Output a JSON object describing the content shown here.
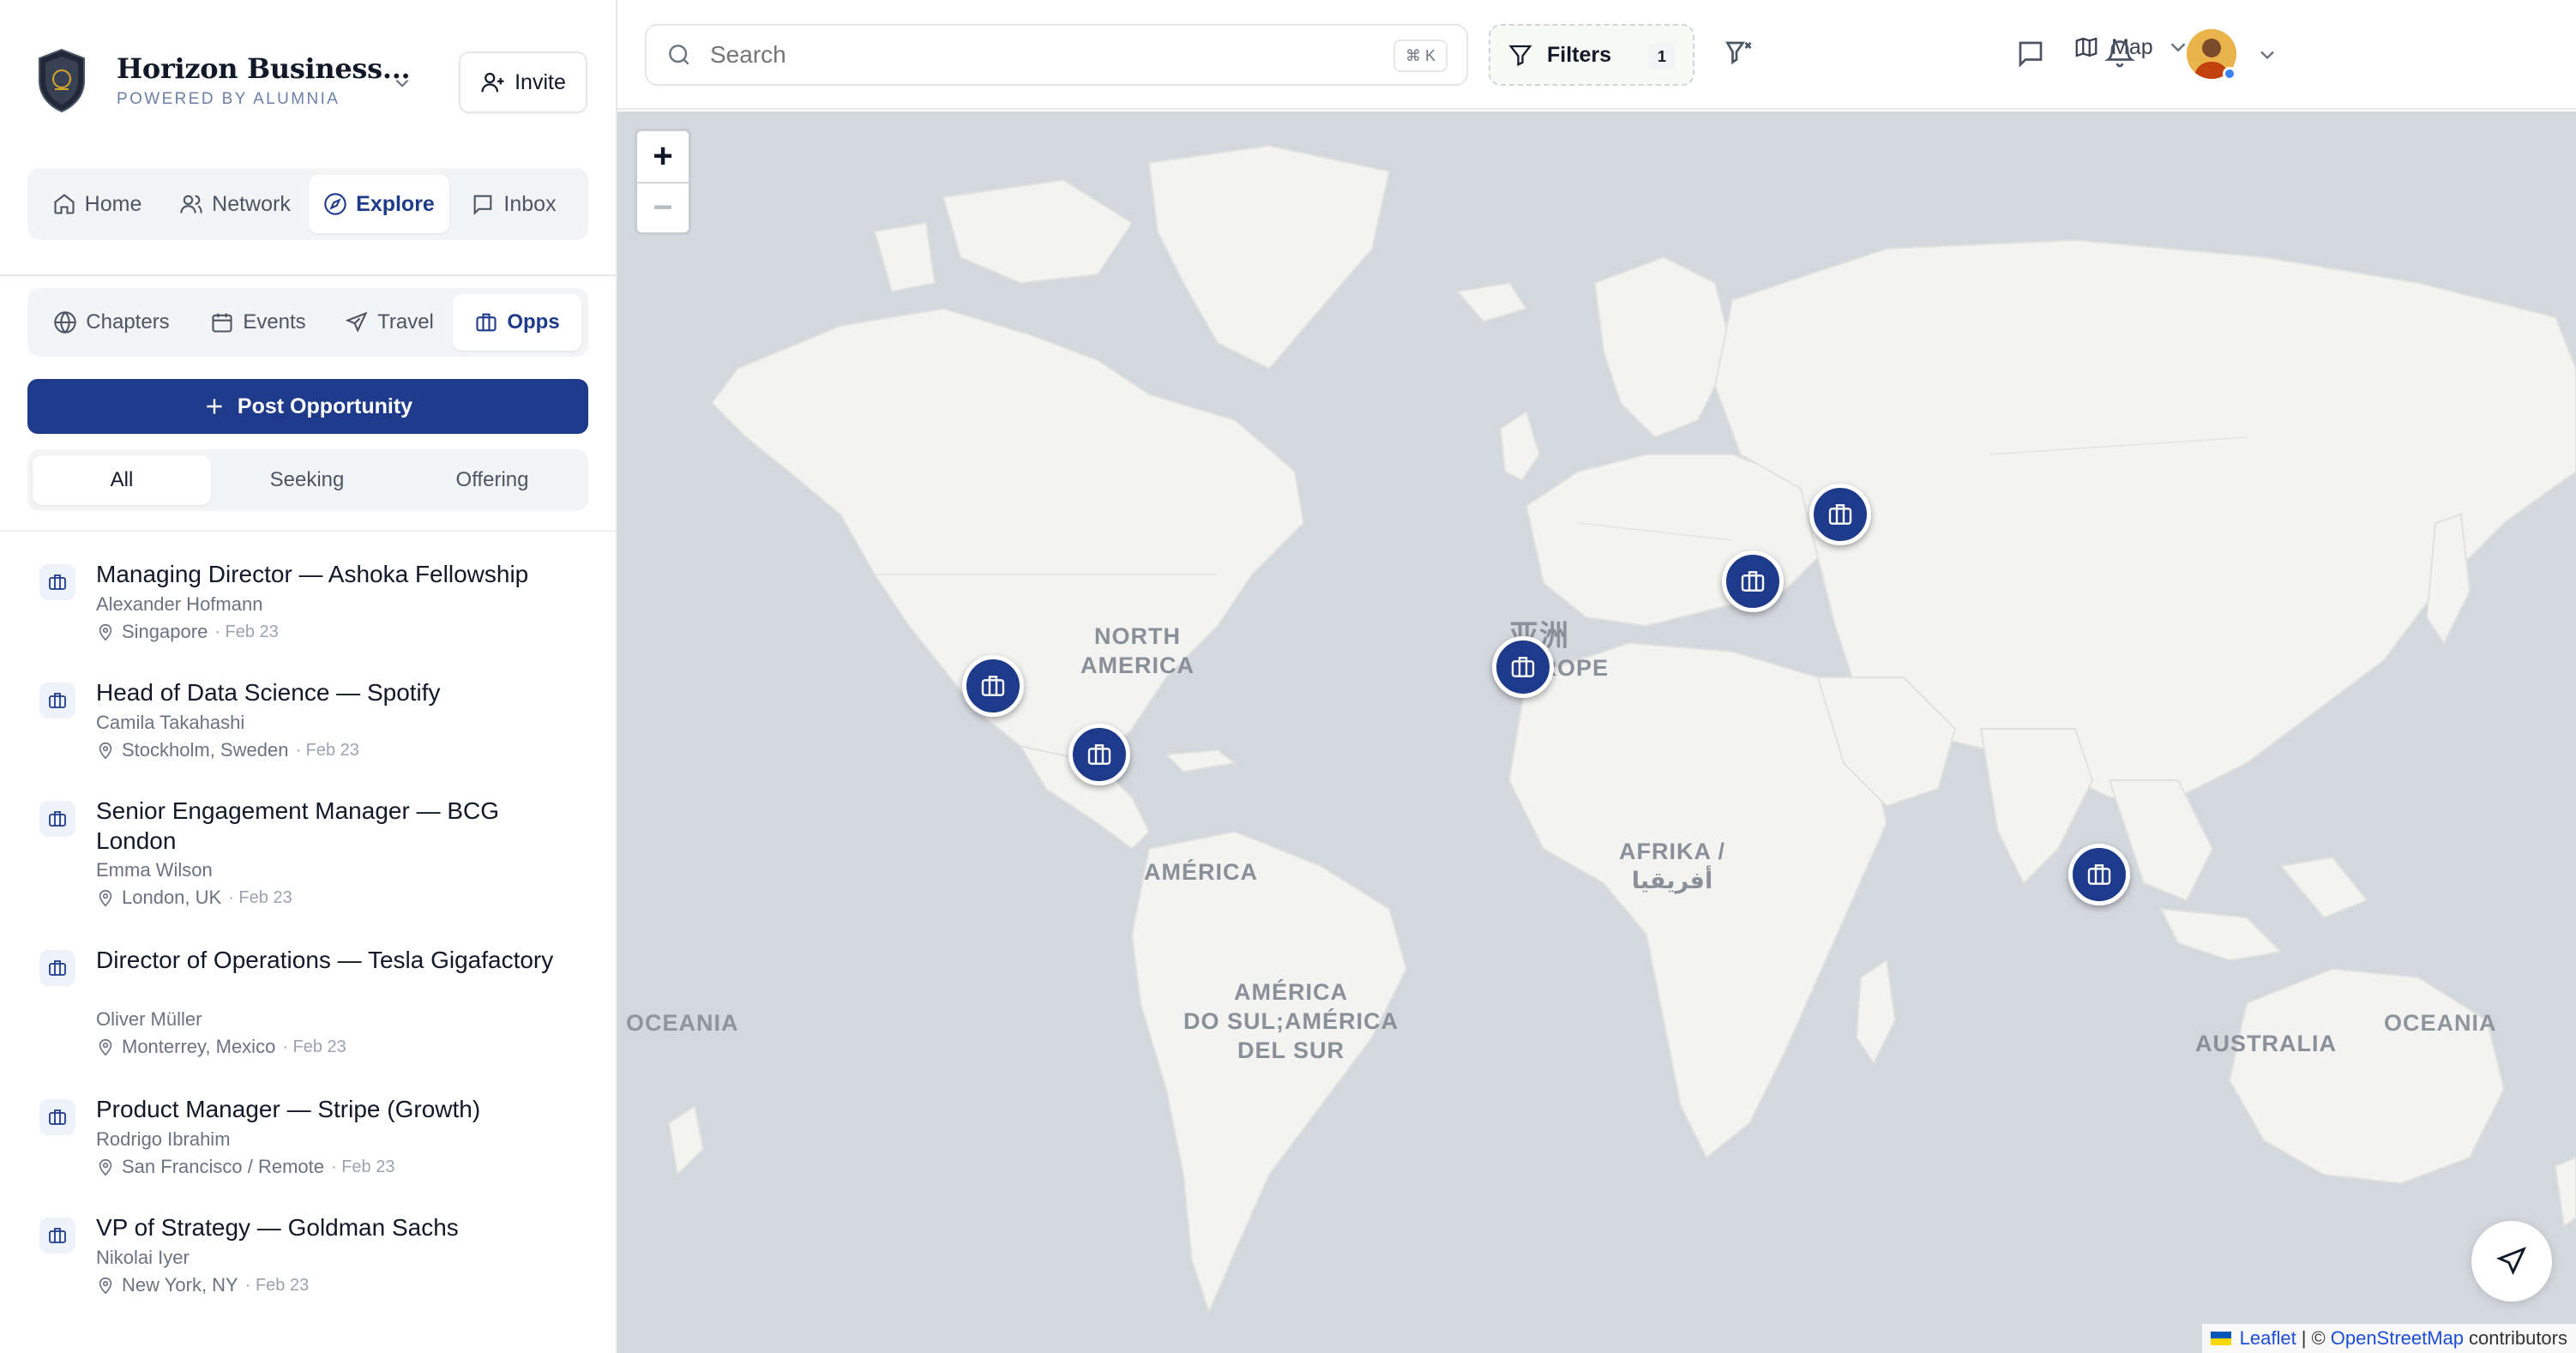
{
  "brand": {
    "name": "Horizon Business...",
    "subtitle": "POWERED BY ALUMNIA"
  },
  "invite_label": "Invite",
  "main_nav": [
    {
      "label": "Home",
      "icon": "home-icon"
    },
    {
      "label": "Network",
      "icon": "users-icon"
    },
    {
      "label": "Explore",
      "icon": "compass-icon",
      "active": true
    },
    {
      "label": "Inbox",
      "icon": "message-icon"
    }
  ],
  "sub_nav": [
    {
      "label": "Chapters",
      "icon": "globe-icon"
    },
    {
      "label": "Events",
      "icon": "calendar-icon"
    },
    {
      "label": "Travel",
      "icon": "plane-icon"
    },
    {
      "label": "Opps",
      "icon": "briefcase-icon",
      "active": true
    }
  ],
  "post_button": "Post Opportunity",
  "filter_tabs": [
    {
      "label": "All",
      "active": true
    },
    {
      "label": "Seeking"
    },
    {
      "label": "Offering"
    }
  ],
  "opportunities": [
    {
      "title": "Managing Director — Ashoka Fellowship",
      "person": "Alexander Hofmann",
      "location": "Singapore",
      "date": "· Feb 23"
    },
    {
      "title": "Head of Data Science — Spotify",
      "person": "Camila Takahashi",
      "location": "Stockholm, Sweden",
      "date": "· Feb 23"
    },
    {
      "title": "Senior Engagement Manager — BCG London",
      "person": "Emma Wilson",
      "location": "London, UK",
      "date": "· Feb 23"
    },
    {
      "title": "Director of Operations — Tesla Gigafactory",
      "person": "Oliver Müller",
      "location": "Monterrey, Mexico",
      "date": "· Feb 23"
    },
    {
      "title": "Product Manager — Stripe (Growth)",
      "person": "Rodrigo Ibrahim",
      "location": "San Francisco / Remote",
      "date": "· Feb 23"
    },
    {
      "title": "VP of Strategy — Goldman Sachs",
      "person": "Nikolai Iyer",
      "location": "New York, NY",
      "date": "· Feb 23"
    }
  ],
  "search": {
    "placeholder": "Search",
    "shortcut": "⌘ K"
  },
  "filters": {
    "label": "Filters",
    "count": "1"
  },
  "map_toggle_label": "Map",
  "map": {
    "zoom_in": "+",
    "zoom_out": "−",
    "labels": {
      "north_america": "NORTH\nAMERICA",
      "europe": "EUROPE",
      "asia": "亚洲",
      "africa": "AFRIKA /\nأفريقيا",
      "america": "AMÉRICA",
      "south_america": "AMÉRICA\nDO SUL;AMÉRICA\nDEL SUR",
      "oceania_left": "OCEANIA",
      "oceania_right": "OCEANIA",
      "australia": "AUSTRALIA"
    },
    "attribution": {
      "leaflet": "Leaflet",
      "sep": "| ©",
      "osm": "OpenStreetMap",
      "suffix": "contributors"
    }
  },
  "colors": {
    "primary": "#1e3a8a",
    "map_water": "#d3d8dd",
    "map_land": "#f3f3f1",
    "avatar_status": "#3b82f6"
  }
}
